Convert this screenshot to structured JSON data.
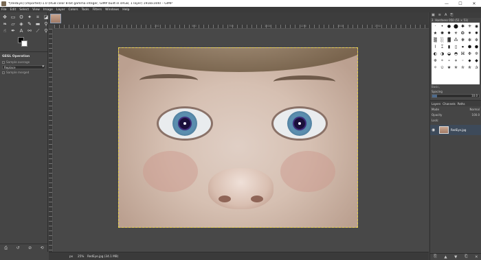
{
  "window": {
    "title": "*[RedEye] (imported)-1.0 (RGB color 8-bit gamma integer, GIMP built-in sRGB, 1 layer) 1918x1440 – GIMP",
    "minimize": "—",
    "maximize": "☐",
    "close": "✕"
  },
  "menu": [
    "File",
    "Edit",
    "Select",
    "View",
    "Image",
    "Layer",
    "Colors",
    "Tools",
    "Filters",
    "Windows",
    "Help"
  ],
  "toolbox": {
    "tools": [
      {
        "icon": "move-icon",
        "glyph": "✥"
      },
      {
        "icon": "rect-select-icon",
        "glyph": "▭"
      },
      {
        "icon": "lasso-icon",
        "glyph": "ʘ"
      },
      {
        "icon": "fuzzy-select-icon",
        "glyph": "✦"
      },
      {
        "icon": "crop-icon",
        "glyph": "⌗"
      },
      {
        "icon": "unified-transform-icon",
        "glyph": "◪"
      },
      {
        "icon": "warp-icon",
        "glyph": "❧"
      },
      {
        "icon": "shear-icon",
        "glyph": "▱"
      },
      {
        "icon": "bucket-fill-icon",
        "glyph": "◈"
      },
      {
        "icon": "paintbrush-icon",
        "glyph": "✎"
      },
      {
        "icon": "eraser-icon",
        "glyph": "▬"
      },
      {
        "icon": "clone-icon",
        "glyph": "⚲"
      },
      {
        "icon": "smudge-icon",
        "glyph": "☝"
      },
      {
        "icon": "paths-icon",
        "glyph": "✒"
      },
      {
        "icon": "text-icon",
        "glyph": "A"
      },
      {
        "icon": "color-picker-icon",
        "glyph": "⚯"
      },
      {
        "icon": "measure-icon",
        "glyph": "⟋"
      },
      {
        "icon": "zoom-icon",
        "glyph": "⚲"
      }
    ],
    "options_title": "GEGL Operation",
    "options_label": "Sample average",
    "mode_value": "Replace",
    "sample_merged": "Sample merged",
    "bottom_icons": [
      "⎙",
      "↺",
      "⊘",
      "⟲"
    ]
  },
  "ruler": {
    "labels": [
      "0",
      "250",
      "500",
      "750",
      "1000",
      "1250",
      "1500",
      "1750"
    ]
  },
  "statusbar": {
    "unit": "px",
    "zoom": "25%",
    "info": "RedEye.jpg (34.1 MB)"
  },
  "dock": {
    "tabs": [
      "▣",
      "≡",
      "A",
      "⎘"
    ],
    "brush_header": "2. Hardness 050 (51 × 51)",
    "brush_tag": "Basic,",
    "spacing_label": "Spacing",
    "spacing_value": "10.0",
    "spacing_fraction": 0.1,
    "brush_glyphs": [
      "·",
      "•",
      "●",
      "⬤",
      "✱",
      "✳",
      "◉",
      "★",
      "✺",
      "✸",
      "☀",
      "❂",
      "✷",
      "✹",
      "▒",
      "░",
      "▓",
      "⁂",
      "❋",
      "✻",
      "✼",
      "⌇",
      "⌶",
      "▮",
      "▯",
      "⦁",
      "⬢",
      "⬣",
      "◐",
      "◑",
      "◒",
      "◓",
      "⌘",
      "❉",
      "❊",
      "❈",
      "⚬",
      "∘",
      "⋄",
      "◦",
      "⬥",
      "◆",
      "✧",
      "✩",
      "✬",
      "✭",
      "✮",
      "✯",
      "✰"
    ],
    "layers_tabs": [
      "Layers",
      "Channels",
      "Paths"
    ],
    "mode_label": "Mode",
    "mode_value": "Normal",
    "opacity_label": "Opacity",
    "opacity_value": "100.0",
    "lock_label": "Lock:",
    "layer_name": "RedEye.jpg",
    "bottom_icons": [
      "⎘",
      "▲",
      "▼",
      "⎗",
      "✕"
    ]
  }
}
